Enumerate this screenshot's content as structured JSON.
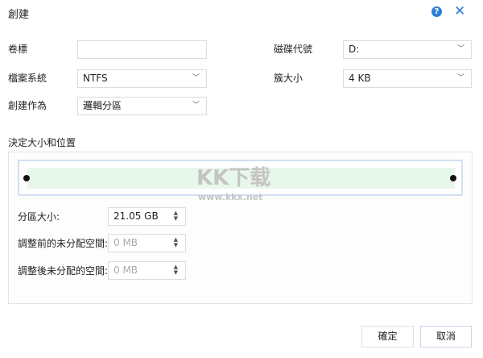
{
  "dialog": {
    "title": "創建"
  },
  "form": {
    "volume_label": {
      "label": "卷標",
      "value": ""
    },
    "drive_letter": {
      "label": "磁碟代號",
      "value": "D:"
    },
    "file_system": {
      "label": "檔案系統",
      "value": "NTFS"
    },
    "cluster_size": {
      "label": "簇大小",
      "value": "4 KB"
    },
    "create_as": {
      "label": "創建作為",
      "value": "邏輯分區"
    }
  },
  "size_section": {
    "title": "決定大小和位置",
    "partition_size": {
      "label": "分區大小:",
      "value": "21.05 GB"
    },
    "unallocated_before": {
      "label": "調整前的未分配空間:",
      "value": "0 MB"
    },
    "unallocated_after": {
      "label": "調整後未分配的空間:",
      "value": "0 MB"
    }
  },
  "watermark": {
    "logo": "KK下载",
    "url": "www.kkx.net"
  },
  "buttons": {
    "ok": "確定",
    "cancel": "取消"
  }
}
